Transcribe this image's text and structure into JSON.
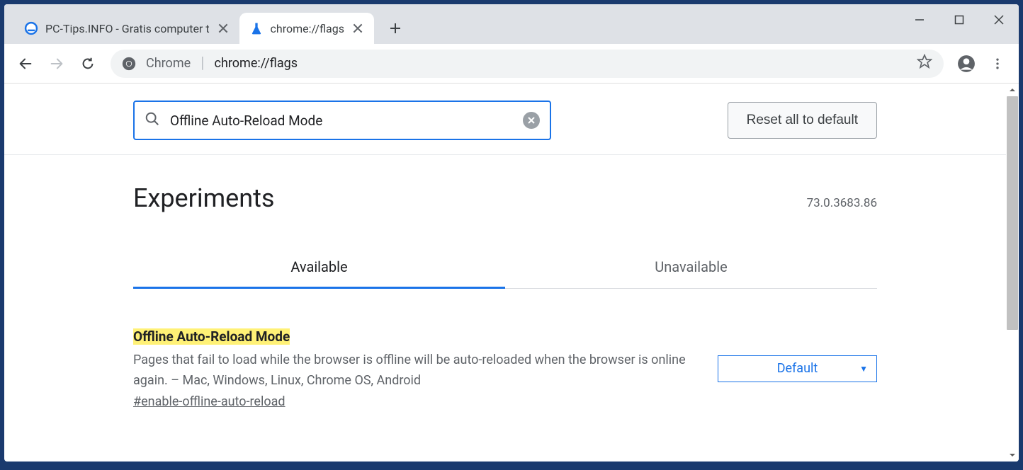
{
  "tabs": [
    {
      "title": "PC-Tips.INFO - Gratis computer t",
      "active": false
    },
    {
      "title": "chrome://flags",
      "active": true
    }
  ],
  "omnibox": {
    "prefix": "Chrome",
    "url": "chrome://flags"
  },
  "flags": {
    "search": {
      "value": "Offline Auto-Reload Mode"
    },
    "reset_label": "Reset all to default",
    "page_title": "Experiments",
    "version": "73.0.3683.86",
    "tabs": [
      {
        "label": "Available",
        "active": true
      },
      {
        "label": "Unavailable",
        "active": false
      }
    ],
    "item": {
      "title": "Offline Auto-Reload Mode",
      "description": "Pages that fail to load while the browser is offline will be auto-reloaded when the browser is online again. – Mac, Windows, Linux, Chrome OS, Android",
      "hash": "#enable-offline-auto-reload",
      "select_value": "Default"
    }
  }
}
